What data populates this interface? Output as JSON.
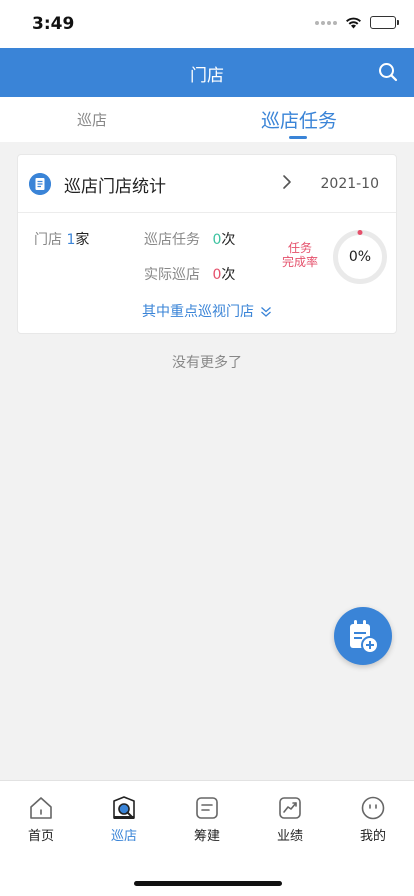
{
  "status_bar": {
    "time": "3:49"
  },
  "header": {
    "title": "门店",
    "search_icon": "search-icon"
  },
  "tabs": [
    {
      "label": "巡店",
      "active": false
    },
    {
      "label": "巡店任务",
      "active": true
    }
  ],
  "card": {
    "title": "巡店门店统计",
    "date": "2021-10",
    "stores": {
      "label": "门店",
      "value": "1",
      "unit": "家"
    },
    "patrol_tasks": {
      "label": "巡店任务",
      "value": "0",
      "unit": "次"
    },
    "actual_patrols": {
      "label": "实际巡店",
      "value": "0",
      "unit": "次"
    },
    "completion_rate": {
      "label_line1": "任务",
      "label_line2": "完成率",
      "value": "0%",
      "fraction": 0
    },
    "key_stores_link": "其中重点巡视门店"
  },
  "no_more": "没有更多了",
  "bottom_nav": [
    {
      "label": "首页",
      "icon": "home-icon",
      "active": false
    },
    {
      "label": "巡店",
      "icon": "store-patrol-icon",
      "active": true
    },
    {
      "label": "筹建",
      "icon": "construction-icon",
      "active": false
    },
    {
      "label": "业绩",
      "icon": "performance-icon",
      "active": false
    },
    {
      "label": "我的",
      "icon": "profile-icon",
      "active": false
    }
  ],
  "colors": {
    "primary": "#3a84d7",
    "red": "#e5506b",
    "green": "#3cc2a0"
  }
}
